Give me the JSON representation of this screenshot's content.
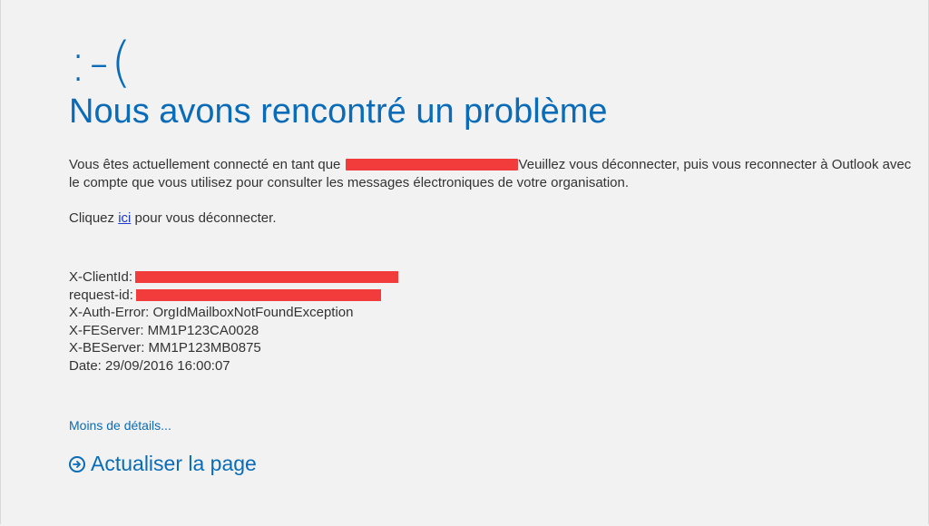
{
  "error": {
    "emoticon": ":-(",
    "title": "Nous avons rencontré un problème",
    "message_before": "Vous êtes actuellement connecté en tant que ",
    "message_after": "Veuillez vous déconnecter, puis vous reconnecter à Outlook avec le compte que vous utilisez pour consulter les messages électroniques de votre organisation.",
    "signout_prefix": "Cliquez ",
    "signout_link": "ici",
    "signout_suffix": " pour vous déconnecter."
  },
  "details": {
    "client_id_label": "X-ClientId:",
    "request_id_label": "request-id:",
    "auth_error": "X-Auth-Error: OrgIdMailboxNotFoundException",
    "fe_server": "X-FEServer: MM1P123CA0028",
    "be_server": "X-BEServer: MM1P123MB0875",
    "date": "Date: 29/09/2016 16:00:07"
  },
  "actions": {
    "less_details": "Moins de détails...",
    "refresh": "Actualiser la page"
  },
  "colors": {
    "accent": "#0a6cb8",
    "redaction": "#f23c3c",
    "background": "#f2f2f2"
  },
  "icons": {
    "refresh": "circle-arrow-right-icon"
  }
}
